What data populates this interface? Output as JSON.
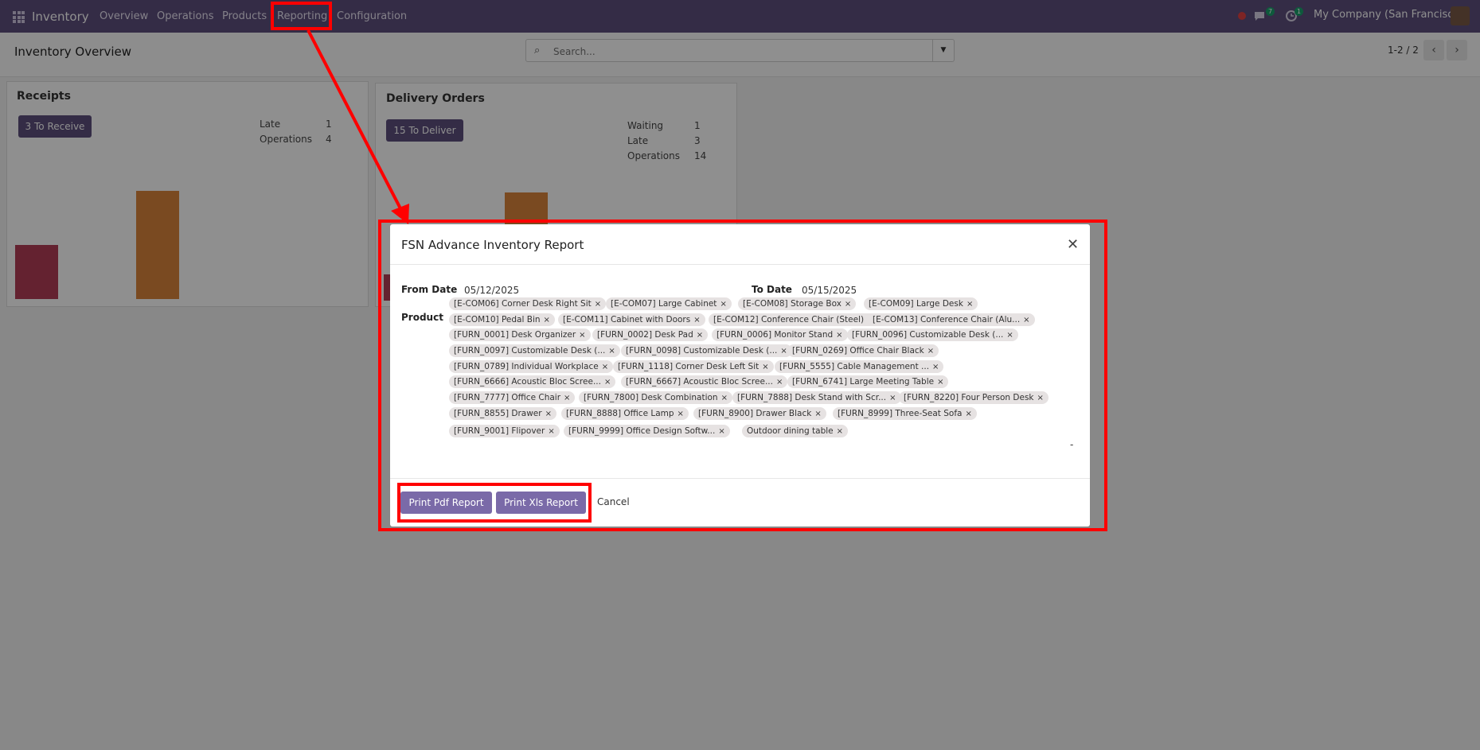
{
  "navbar": {
    "app_name": "Inventory",
    "menu": [
      "Overview",
      "Operations",
      "Products",
      "Reporting",
      "Configuration"
    ],
    "messages_badge": "7",
    "activities_badge": "1",
    "company": "My Company (San Francisco)",
    "icons": [
      "apps-grid-icon",
      "bug-icon",
      "chat-icon",
      "clock-icon",
      "avatar"
    ]
  },
  "control_panel": {
    "title": "Inventory Overview",
    "search_placeholder": "Search...",
    "pager": "1-2 / 2"
  },
  "cards": [
    {
      "title": "Receipts",
      "button": "3 To Receive",
      "stats": [
        {
          "label": "Late",
          "value": "1"
        },
        {
          "label": "Operations",
          "value": "4"
        }
      ],
      "bars": [
        {
          "color": "#b33e57",
          "level": 0.5
        },
        {
          "color": "#d9853b",
          "level": 1.0
        }
      ]
    },
    {
      "title": "Delivery Orders",
      "button": "15 To Deliver",
      "stats": [
        {
          "label": "Waiting",
          "value": "1"
        },
        {
          "label": "Late",
          "value": "3"
        },
        {
          "label": "Operations",
          "value": "14"
        }
      ]
    }
  ],
  "modal": {
    "title": "FSN Advance Inventory Report",
    "from_date_label": "From Date",
    "from_date": "05/12/2025",
    "to_date_label": "To Date",
    "to_date": "05/15/2025",
    "product_label": "Product",
    "products": [
      "[E-COM06] Corner Desk Right Sit",
      "[E-COM07] Large Cabinet",
      "[E-COM08] Storage Box",
      "[E-COM09] Large Desk",
      "[E-COM10] Pedal Bin",
      "[E-COM11] Cabinet with Doors",
      "[E-COM12] Conference Chair (Steel)",
      "[E-COM13] Conference Chair (Alu...",
      "[FURN_0001] Desk Organizer",
      "[FURN_0002] Desk Pad",
      "[FURN_0006] Monitor Stand",
      "[FURN_0096] Customizable Desk (...",
      "[FURN_0097] Customizable Desk (...",
      "[FURN_0098] Customizable Desk (...",
      "[FURN_0269] Office Chair Black",
      "[FURN_0789] Individual Workplace",
      "[FURN_1118] Corner Desk Left Sit",
      "[FURN_5555] Cable Management ...",
      "[FURN_6666] Acoustic Bloc Scree...",
      "[FURN_6667] Acoustic Bloc Scree...",
      "[FURN_6741] Large Meeting Table",
      "[FURN_7777] Office Chair",
      "[FURN_7800] Desk Combination",
      "[FURN_7888] Desk Stand with Scr...",
      "[FURN_8220] Four Person Desk",
      "[FURN_8855] Drawer",
      "[FURN_8888] Office Lamp",
      "[FURN_8900] Drawer Black",
      "[FURN_8999] Three-Seat Sofa",
      "[FURN_9001] Flipover",
      "[FURN_9999] Office Design Softw...",
      "Outdoor dining table"
    ],
    "tag_remove_glyph": "×",
    "dropdown_glyph": "-",
    "print_pdf_label": "Print Pdf Report",
    "print_xls_label": "Print Xls Report",
    "cancel_label": "Cancel",
    "close_glyph": "✕"
  }
}
